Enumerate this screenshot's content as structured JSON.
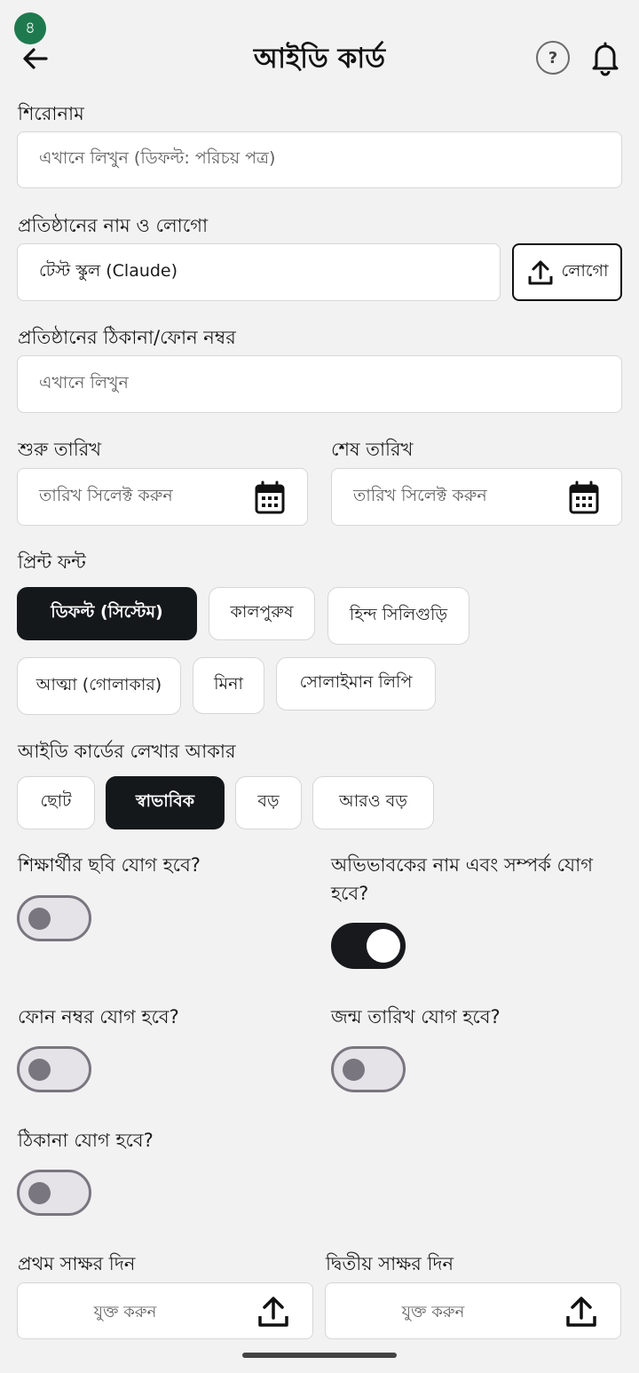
{
  "status": {
    "badge": "৪"
  },
  "header": {
    "title": "আইডি কার্ড",
    "help": "?"
  },
  "form": {
    "title_label": "শিরোনাম",
    "title_placeholder": "এখানে লিখুন (ডিফল্ট: পরিচয় পত্র)",
    "org_label": "প্রতিষ্ঠানের নাম ও লোগো",
    "org_value": "টেস্ট স্কুল (Claude)",
    "logo_button": "লোগো",
    "address_label": "প্রতিষ্ঠানের ঠিকানা/ফোন নম্বর",
    "address_placeholder": "এখানে লিখুন",
    "start_date_label": "শুরু তারিখ",
    "end_date_label": "শেষ তারিখ",
    "date_placeholder": "তারিখ সিলেক্ট করুন",
    "font_label": "প্রিন্ট ফন্ট",
    "fonts": [
      "ডিফল্ট (সিস্টেম)",
      "কালপুরুষ",
      "হিন্দ সিলিগুড়ি",
      "আত্মা (গোলাকার)",
      "মিনা",
      "সোলাইমান লিপি"
    ],
    "size_label": "আইডি কার্ডের লেখার আকার",
    "sizes": [
      "ছোট",
      "স্বাভাবিক",
      "বড়",
      "আরও বড়"
    ],
    "toggles": {
      "photo": "শিক্ষার্থীর ছবি যোগ হবে?",
      "guardian": "অভিভাবকের নাম এবং সম্পর্ক যোগ হবে?",
      "phone": "ফোন নম্বর যোগ হবে?",
      "dob": "জন্ম তারিখ যোগ হবে?",
      "address": "ঠিকানা যোগ হবে?"
    },
    "sign1_label": "প্রথম সাক্ষর দিন",
    "sign2_label": "দ্বিতীয় সাক্ষর দিন",
    "upload_text": "যুক্ত করুন"
  },
  "state": {
    "selected_font": "ডিফল্ট (সিস্টেম)",
    "selected_size": "স্বাভাবিক",
    "photo": false,
    "guardian": true,
    "phone": false,
    "dob": false,
    "address": false
  },
  "icons": [
    "arrow-left-icon",
    "help-icon",
    "bell-icon",
    "upload-icon",
    "calendar-icon"
  ],
  "colors": {
    "badge": "#1e7a4e",
    "selected": "#15181b",
    "background": "#f2f2f2"
  }
}
